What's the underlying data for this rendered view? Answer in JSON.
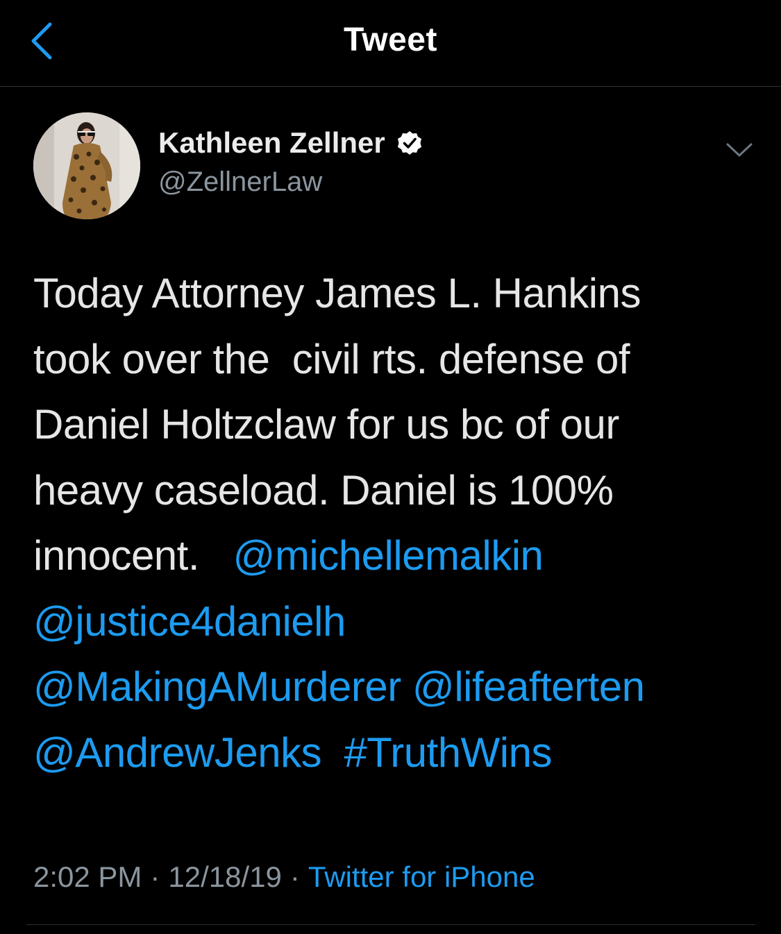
{
  "colors": {
    "background": "#000000",
    "link": "#1d9bf0",
    "secondary_text": "#8b959e",
    "primary_text": "#e6e6e6",
    "divider": "#2f3336"
  },
  "nav": {
    "back_icon": "chevron-left-icon",
    "title": "Tweet"
  },
  "author": {
    "display_name": "Kathleen Zellner",
    "verified_icon": "verified-badge-icon",
    "handle": "@ZellnerLaw",
    "menu_icon": "chevron-down-icon"
  },
  "tweet": {
    "lines": [
      [
        {
          "text": "Today Attorney James L. Hankins",
          "link": false
        }
      ],
      [
        {
          "text": "took over the  civil rts. defense of",
          "link": false
        }
      ],
      [
        {
          "text": "Daniel Holtzclaw for us bc of our",
          "link": false
        }
      ],
      [
        {
          "text": "heavy caseload. Daniel is 100%",
          "link": false
        }
      ],
      [
        {
          "text": "innocent.   ",
          "link": false
        },
        {
          "text": "@michellemalkin",
          "link": true
        }
      ],
      [
        {
          "text": "@justice4danielh",
          "link": true
        }
      ],
      [
        {
          "text": "@MakingAMurderer",
          "link": true
        },
        {
          "text": " ",
          "link": false
        },
        {
          "text": "@lifeafterten",
          "link": true
        }
      ],
      [
        {
          "text": "@AndrewJenks",
          "link": true
        },
        {
          "text": "  ",
          "link": false
        },
        {
          "text": "#TruthWins",
          "link": true
        }
      ]
    ]
  },
  "meta": {
    "time": "2:02 PM",
    "date": "12/18/19",
    "separator": "·",
    "source": "Twitter for iPhone"
  }
}
